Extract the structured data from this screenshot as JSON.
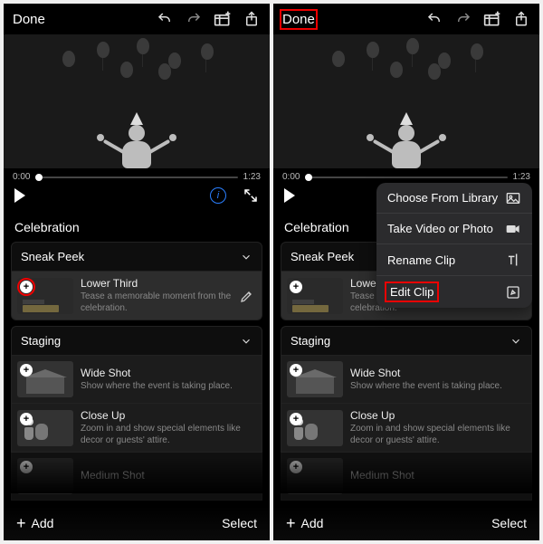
{
  "topbar": {
    "done": "Done"
  },
  "time": {
    "current": "0:00",
    "total": "1:23"
  },
  "section": "Celebration",
  "groups": {
    "sneak": {
      "title": "Sneak Peek",
      "clip1": {
        "title": "Lower Third",
        "desc": "Tease a memorable moment from the celebration."
      }
    },
    "staging": {
      "title": "Staging",
      "wide": {
        "title": "Wide Shot",
        "desc": "Show where the event is taking place."
      },
      "close": {
        "title": "Close Up",
        "desc": "Zoom in and show special elements like decor or guests' attire."
      },
      "medium": {
        "title": "Medium Shot"
      }
    }
  },
  "bottom": {
    "add": "Add",
    "select": "Select"
  },
  "popup": {
    "choose": "Choose From Library",
    "take": "Take Video or Photo",
    "rename": "Rename Clip",
    "edit": "Edit Clip"
  }
}
